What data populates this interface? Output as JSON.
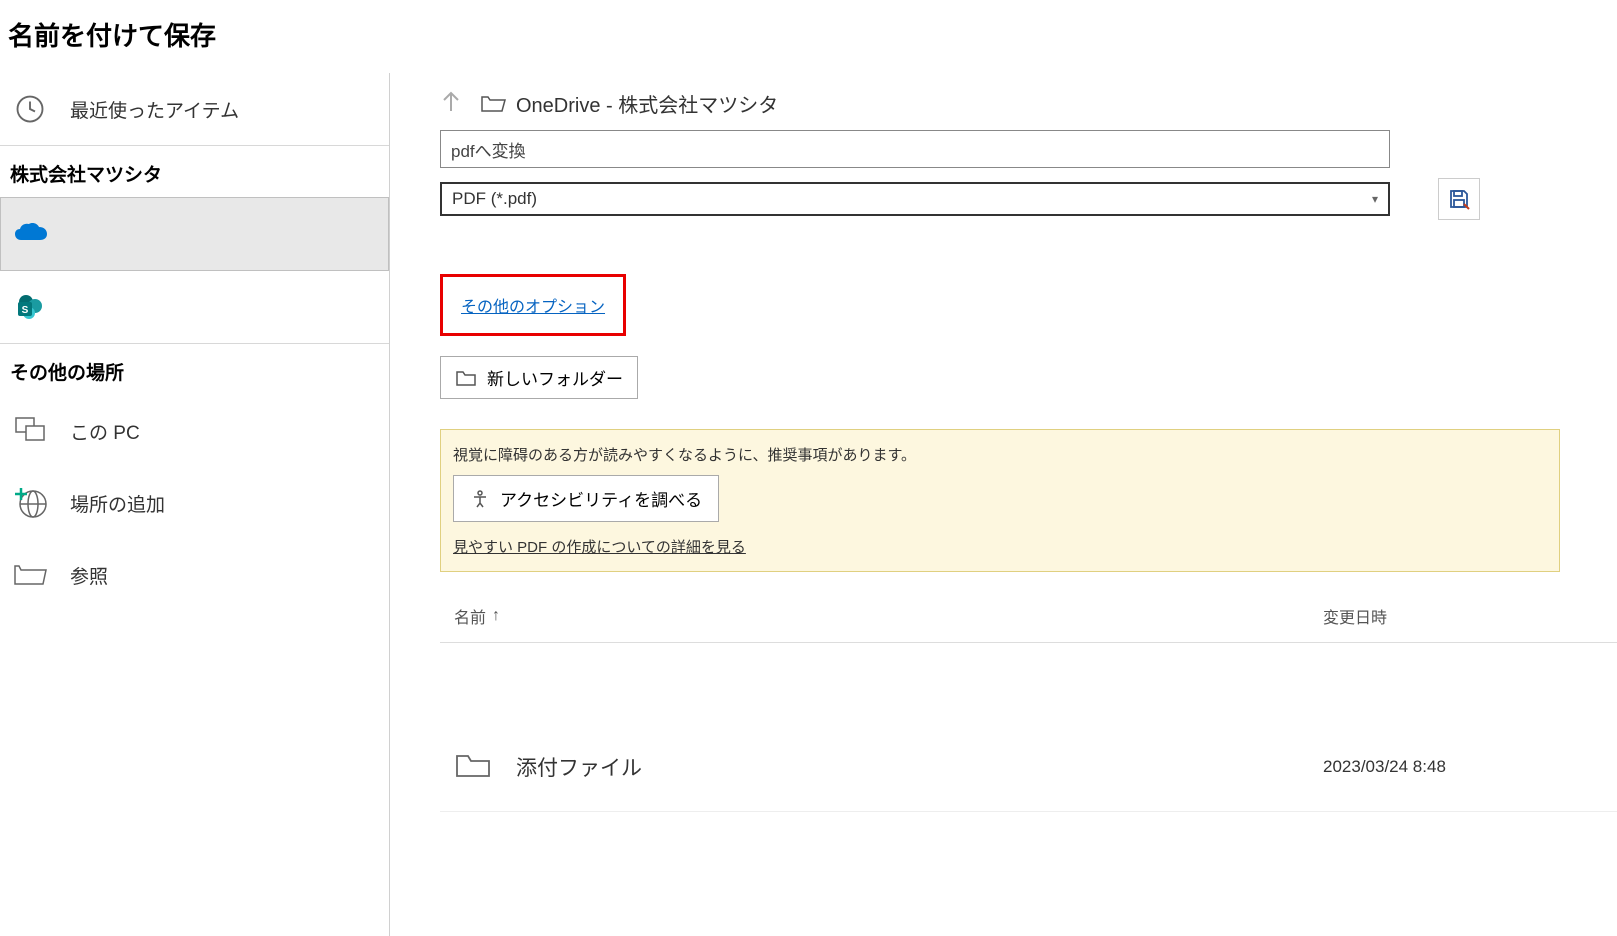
{
  "title": "名前を付けて保存",
  "sidebar": {
    "recent": "最近使ったアイテム",
    "org_header": "株式会社マツシタ",
    "other_header": "その他の場所",
    "this_pc": "この PC",
    "add_place": "場所の追加",
    "browse": "参照"
  },
  "breadcrumb": {
    "location": "OneDrive - 株式会社マツシタ"
  },
  "filename": "pdfへ変換",
  "filetype": "PDF (*.pdf)",
  "more_options": "その他のオプション",
  "new_folder": "新しいフォルダー",
  "accessibility": {
    "message": "視覚に障碍のある方が読みやすくなるように、推奨事項があります。",
    "button": "アクセシビリティを調べる",
    "link": "見やすい PDF の作成についての詳細を見る"
  },
  "columns": {
    "name": "名前",
    "date": "変更日時"
  },
  "files": [
    {
      "name": "添付ファイル",
      "date": "2023/03/24 8:48"
    }
  ]
}
